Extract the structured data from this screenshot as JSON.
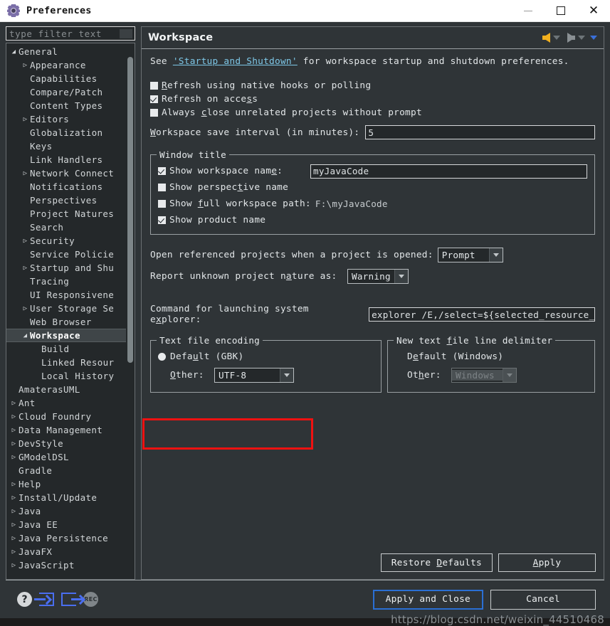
{
  "window": {
    "title": "Preferences",
    "icon": "gear-icon",
    "controls": {
      "minimize": "—",
      "maximize": "□",
      "close": "✕"
    }
  },
  "sidebar": {
    "filter": {
      "placeholder": "type filter text",
      "value": ""
    },
    "items": [
      {
        "label": "General",
        "indent": 0,
        "twisty": "expanded"
      },
      {
        "label": "Appearance",
        "indent": 1,
        "twisty": "collapsed"
      },
      {
        "label": "Capabilities",
        "indent": 1,
        "twisty": "none"
      },
      {
        "label": "Compare/Patch",
        "indent": 1,
        "twisty": "none"
      },
      {
        "label": "Content Types",
        "indent": 1,
        "twisty": "none"
      },
      {
        "label": "Editors",
        "indent": 1,
        "twisty": "collapsed"
      },
      {
        "label": "Globalization",
        "indent": 1,
        "twisty": "none"
      },
      {
        "label": "Keys",
        "indent": 1,
        "twisty": "none"
      },
      {
        "label": "Link Handlers",
        "indent": 1,
        "twisty": "none"
      },
      {
        "label": "Network Connect",
        "indent": 1,
        "twisty": "collapsed"
      },
      {
        "label": "Notifications",
        "indent": 1,
        "twisty": "none"
      },
      {
        "label": "Perspectives",
        "indent": 1,
        "twisty": "none"
      },
      {
        "label": "Project Natures",
        "indent": 1,
        "twisty": "none"
      },
      {
        "label": "Search",
        "indent": 1,
        "twisty": "none"
      },
      {
        "label": "Security",
        "indent": 1,
        "twisty": "collapsed"
      },
      {
        "label": "Service Policie",
        "indent": 1,
        "twisty": "none"
      },
      {
        "label": "Startup and Shu",
        "indent": 1,
        "twisty": "collapsed"
      },
      {
        "label": "Tracing",
        "indent": 1,
        "twisty": "none"
      },
      {
        "label": "UI Responsivene",
        "indent": 1,
        "twisty": "none"
      },
      {
        "label": "User Storage Se",
        "indent": 1,
        "twisty": "collapsed"
      },
      {
        "label": "Web Browser",
        "indent": 1,
        "twisty": "none"
      },
      {
        "label": "Workspace",
        "indent": 1,
        "twisty": "expanded",
        "selected": true
      },
      {
        "label": "Build",
        "indent": 2,
        "twisty": "none"
      },
      {
        "label": "Linked Resour",
        "indent": 2,
        "twisty": "none"
      },
      {
        "label": "Local History",
        "indent": 2,
        "twisty": "none"
      },
      {
        "label": "AmaterasUML",
        "indent": 0,
        "twisty": "none"
      },
      {
        "label": "Ant",
        "indent": 0,
        "twisty": "collapsed"
      },
      {
        "label": "Cloud Foundry",
        "indent": 0,
        "twisty": "collapsed"
      },
      {
        "label": "Data Management",
        "indent": 0,
        "twisty": "collapsed"
      },
      {
        "label": "DevStyle",
        "indent": 0,
        "twisty": "collapsed"
      },
      {
        "label": "GModelDSL",
        "indent": 0,
        "twisty": "collapsed"
      },
      {
        "label": "Gradle",
        "indent": 0,
        "twisty": "none"
      },
      {
        "label": "Help",
        "indent": 0,
        "twisty": "collapsed"
      },
      {
        "label": "Install/Update",
        "indent": 0,
        "twisty": "collapsed"
      },
      {
        "label": "Java",
        "indent": 0,
        "twisty": "collapsed"
      },
      {
        "label": "Java EE",
        "indent": 0,
        "twisty": "collapsed"
      },
      {
        "label": "Java Persistence",
        "indent": 0,
        "twisty": "collapsed"
      },
      {
        "label": "JavaFX",
        "indent": 0,
        "twisty": "collapsed"
      },
      {
        "label": "JavaScript",
        "indent": 0,
        "twisty": "collapsed"
      }
    ]
  },
  "panel": {
    "title": "Workspace",
    "intro": {
      "prefix": "See ",
      "link": "'Startup and Shutdown'",
      "suffix": " for workspace startup and shutdown preferences."
    },
    "checkboxes": [
      {
        "label": "Refresh using native hooks or polling",
        "checked": false
      },
      {
        "label": "Refresh on access",
        "checked": true
      },
      {
        "label": "Always close unrelated projects without prompt",
        "checked": false
      }
    ],
    "save_interval": {
      "label": "Workspace save interval (in minutes):",
      "value": "5"
    },
    "window_title_group": {
      "legend": "Window title",
      "show_workspace_name": {
        "label": "Show workspace name:",
        "checked": true,
        "value": "myJavaCode"
      },
      "show_perspective_name": {
        "label": "Show perspective name",
        "checked": false
      },
      "show_full_path": {
        "label": "Show full workspace path:",
        "checked": false,
        "value": "F:\\myJavaCode"
      },
      "show_product_name": {
        "label": "Show product name",
        "checked": true
      }
    },
    "open_referenced": {
      "label": "Open referenced projects when a project is opened:",
      "value": "Prompt"
    },
    "report_nature": {
      "label": "Report unknown project nature as:",
      "value": "Warning"
    },
    "explorer_command": {
      "label": "Command for launching system explorer:",
      "value": "explorer /E,/select=${selected_resource_"
    },
    "encoding_group": {
      "legend": "Text file encoding",
      "default_label": "Default (GBK)",
      "default_selected": true,
      "other_label": "Other:",
      "other_value": "UTF-8",
      "highlight_color": "#ef1111"
    },
    "delimiter_group": {
      "legend": "New text file line delimiter",
      "default_label": "Default (Windows)",
      "default_selected": false,
      "other_label": "Other:",
      "other_value": "Windows",
      "other_disabled": true
    },
    "buttons": {
      "restore": "Restore Defaults",
      "apply": "Apply"
    },
    "nav": {
      "back": "back-arrow",
      "forward": "forward-arrow"
    }
  },
  "footer": {
    "icons": [
      "help-icon",
      "import-icon",
      "export-icon",
      "rec-icon"
    ],
    "help_glyph": "?",
    "rec_glyph": "REC",
    "apply_and_close": "Apply and Close",
    "cancel": "Cancel"
  },
  "watermark": "https://blog.csdn.net/weixin_44510468"
}
